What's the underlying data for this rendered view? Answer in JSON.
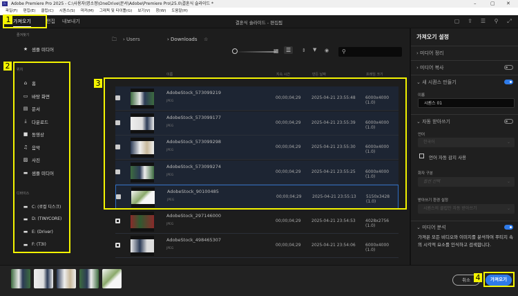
{
  "window": {
    "title": "Adobe Premiere Pro 2025 - C:\\사용자\\명소정\\OneDrive\\문서\\Adobe\\Premiere Pro\\25.0\\결혼식 슬라이드 *",
    "app_icon": "Pr"
  },
  "menu": [
    "파일(F)",
    "편집(E)",
    "클립(C)",
    "시퀀스(S)",
    "마커(M)",
    "그래픽 및 타이틀(G)",
    "보기(V)",
    "창(W)",
    "도움말(H)"
  ],
  "header": {
    "tabs": [
      "가져오기",
      "편집",
      "내보내기"
    ],
    "doc_title": "결혼식 슬라이드 - 편집됨"
  },
  "sidebar": {
    "favorites_label": "즐겨찾기",
    "favorites": [
      {
        "icon": "star-icon",
        "label": "샘플 미디어"
      }
    ],
    "locations_label": "위치",
    "locations": [
      {
        "icon": "home-icon",
        "label": "홈"
      },
      {
        "icon": "desktop-icon",
        "label": "바탕 화면"
      },
      {
        "icon": "document-icon",
        "label": "문서"
      },
      {
        "icon": "download-icon",
        "label": "다운로드"
      },
      {
        "icon": "video-icon",
        "label": "동영상"
      },
      {
        "icon": "music-icon",
        "label": "음악"
      },
      {
        "icon": "image-icon",
        "label": "사진"
      },
      {
        "icon": "folder-icon",
        "label": "샘플 미디어"
      }
    ],
    "devices_label": "디바이스",
    "devices": [
      "C: (로컬 디스크)",
      "D: (TINYCORE)",
      "E: (Driver)",
      "F: (T3I)"
    ]
  },
  "browser": {
    "breadcrumb": [
      "Users",
      "Downloads"
    ],
    "columns": [
      "이름",
      "지속 시간",
      "만든 날짜",
      "프레임 크기"
    ],
    "files": [
      {
        "name": "AdobeStock_573099219",
        "type": "JPEG",
        "duration": "00;00;04;29",
        "created": "2025-04-21 23:55:48",
        "frame": "6000x4000 (1.0)",
        "checked": true
      },
      {
        "name": "AdobeStock_573099177",
        "type": "JPEG",
        "duration": "00;00;04;29",
        "created": "2025-04-21 23:55:39",
        "frame": "6000x4000 (1.0)",
        "checked": true
      },
      {
        "name": "AdobeStock_573099298",
        "type": "JPEG",
        "duration": "00;00;04;29",
        "created": "2025-04-21 23:55:30",
        "frame": "6000x4000 (1.0)",
        "checked": true
      },
      {
        "name": "AdobeStock_573099274",
        "type": "JPEG",
        "duration": "00;00;04;29",
        "created": "2025-04-21 23:55:25",
        "frame": "6000x4000 (1.0)",
        "checked": true
      },
      {
        "name": "AdobeStock_90100485",
        "type": "JPEG",
        "duration": "00;00;04;29",
        "created": "2025-04-21 23:55:13",
        "frame": "5150x3428 (1.0)",
        "checked": true
      },
      {
        "name": "AdobeStock_297146000",
        "type": "JPEG",
        "duration": "00;00;04;29",
        "created": "2025-04-21 23:54:53",
        "frame": "4028x2756 (1.0)",
        "checked": false
      },
      {
        "name": "AdobeStock_498465307",
        "type": "JPEG",
        "duration": "00;00;04;29",
        "created": "2025-04-21 23:54:06",
        "frame": "6000x4000 (1.0)",
        "checked": false
      }
    ]
  },
  "settings": {
    "title": "가져오기 설정",
    "organize": "미디어 정리",
    "copy": {
      "label": "미디어 복사",
      "on": false
    },
    "new_sequence": {
      "label": "새 시퀀스 만들기",
      "on": true,
      "name_label": "이름",
      "name_value": "시퀀스 01"
    },
    "captions": {
      "label": "자동 받아쓰기",
      "on": false,
      "language_label": "언어",
      "language_value": "한국어",
      "autodetect": "언어 자동 감지 사용",
      "speaker_label": "화자 구분",
      "speaker_value": "옵션 선택",
      "pref_label": "받아쓰기 환경 설정",
      "pref_value": "시퀀스의 클립만 자동 받아쓰기"
    },
    "analysis": {
      "label": "미디어 분석",
      "on": true,
      "description": "가져온 모든 비디오와 이미지를 분석하여 푸티지 속의 시각적 요소를 인식하고 검색합니다."
    }
  },
  "footer": {
    "cancel": "취소",
    "import": "가져오기"
  },
  "annotations": [
    "1",
    "2",
    "3",
    "4"
  ],
  "colors": {
    "accent": "#2f7be9",
    "highlight": "#f5f500"
  }
}
